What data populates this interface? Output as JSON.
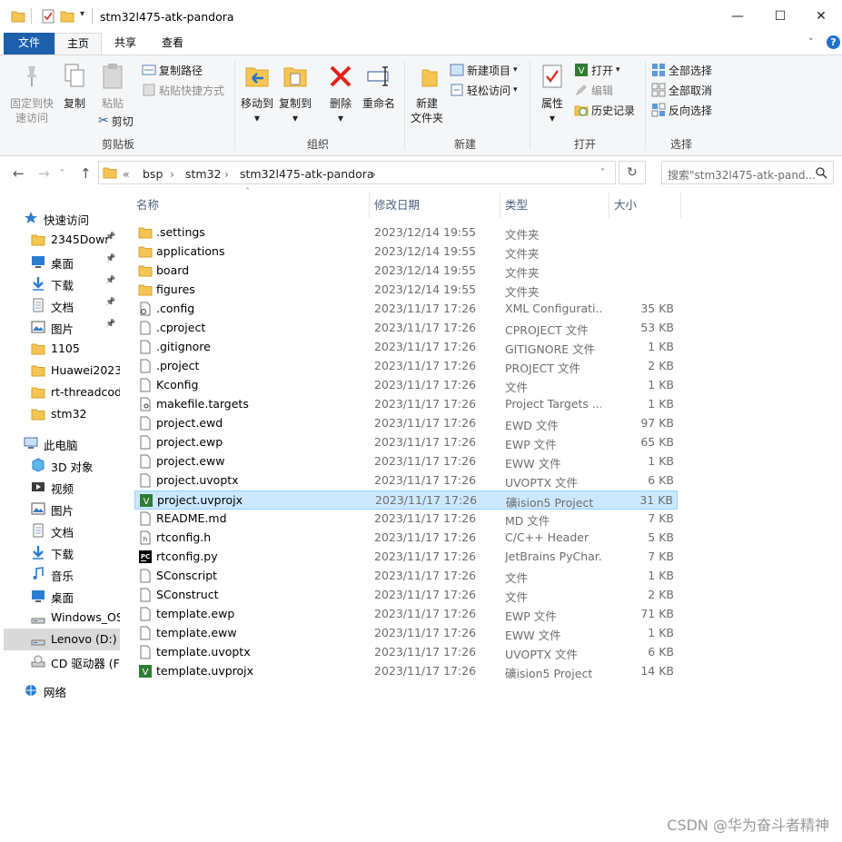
{
  "window": {
    "title": "stm32l475-atk-pandora",
    "minimize": "—",
    "maximize": "☐",
    "close": "✕"
  },
  "ribbon_tabs": [
    "文件",
    "主页",
    "共享",
    "查看"
  ],
  "ribbon": {
    "clipboard": {
      "pin_label_1": "固定到快",
      "pin_label_2": "速访问",
      "copy": "复制",
      "paste": "粘贴",
      "copy_path": "复制路径",
      "paste_shortcut": "粘贴快捷方式",
      "cut": "剪切",
      "group": "剪贴板"
    },
    "organize": {
      "move_to": "移动到",
      "copy_to": "复制到",
      "delete": "删除",
      "rename": "重命名",
      "group": "组织"
    },
    "new": {
      "new_folder_1": "新建",
      "new_folder_2": "文件夹",
      "new_item": "新建项目",
      "easy_access": "轻松访问",
      "group": "新建"
    },
    "open": {
      "properties": "属性",
      "open": "打开",
      "edit": "编辑",
      "history": "历史记录",
      "group": "打开"
    },
    "select": {
      "select_all": "全部选择",
      "select_none": "全部取消",
      "invert": "反向选择",
      "group": "选择"
    }
  },
  "address": {
    "crumbs": [
      "«",
      "bsp",
      "stm32",
      "stm32l475-atk-pandora"
    ],
    "search_placeholder": "搜索\"stm32l475-atk-pand...",
    "search_icon": "search-icon"
  },
  "nav": {
    "items": [
      {
        "label": "快速访问",
        "icon": "star-icon",
        "pinned": false,
        "selected": false
      },
      {
        "label": "2345Dowr",
        "icon": "folder-icon",
        "pinned": true,
        "selected": false
      },
      {
        "label": "桌面",
        "icon": "desktop-icon",
        "pinned": true,
        "selected": false
      },
      {
        "label": "下载",
        "icon": "download-icon",
        "pinned": true,
        "selected": false
      },
      {
        "label": "文档",
        "icon": "document-icon",
        "pinned": true,
        "selected": false
      },
      {
        "label": "图片",
        "icon": "pictures-icon",
        "pinned": true,
        "selected": false
      },
      {
        "label": "1105",
        "icon": "folder-icon",
        "pinned": false,
        "selected": false
      },
      {
        "label": "Huawei2023",
        "icon": "folder-icon",
        "pinned": false,
        "selected": false
      },
      {
        "label": "rt-threadcod",
        "icon": "folder-icon",
        "pinned": false,
        "selected": false
      },
      {
        "label": "stm32",
        "icon": "folder-icon",
        "pinned": false,
        "selected": false
      },
      {
        "label": "此电脑",
        "icon": "computer-icon",
        "pinned": false,
        "selected": false
      },
      {
        "label": "3D 对象",
        "icon": "3d-objects-icon",
        "pinned": false,
        "selected": false
      },
      {
        "label": "视频",
        "icon": "videos-icon",
        "pinned": false,
        "selected": false
      },
      {
        "label": "图片",
        "icon": "pictures-icon",
        "pinned": false,
        "selected": false
      },
      {
        "label": "文档",
        "icon": "document-icon",
        "pinned": false,
        "selected": false
      },
      {
        "label": "下载",
        "icon": "download-icon",
        "pinned": false,
        "selected": false
      },
      {
        "label": "音乐",
        "icon": "music-icon",
        "pinned": false,
        "selected": false
      },
      {
        "label": "桌面",
        "icon": "desktop-icon",
        "pinned": false,
        "selected": false
      },
      {
        "label": "Windows_OS",
        "icon": "drive-icon",
        "pinned": false,
        "selected": false
      },
      {
        "label": "Lenovo (D:)",
        "icon": "drive-icon",
        "pinned": false,
        "selected": true
      },
      {
        "label": "CD 驱动器 (F:",
        "icon": "cd-drive-icon",
        "pinned": false,
        "selected": false
      },
      {
        "label": "网络",
        "icon": "network-icon",
        "pinned": false,
        "selected": false
      }
    ]
  },
  "columns": {
    "name": "名称",
    "date": "修改日期",
    "type": "类型",
    "size": "大小"
  },
  "files": [
    {
      "name": ".settings",
      "date": "2023/12/14 19:55",
      "type": "文件夹",
      "size": "",
      "icon": "folder-icon"
    },
    {
      "name": "applications",
      "date": "2023/12/14 19:55",
      "type": "文件夹",
      "size": "",
      "icon": "folder-icon"
    },
    {
      "name": "board",
      "date": "2023/12/14 19:55",
      "type": "文件夹",
      "size": "",
      "icon": "folder-icon"
    },
    {
      "name": "figures",
      "date": "2023/12/14 19:55",
      "type": "文件夹",
      "size": "",
      "icon": "folder-icon"
    },
    {
      "name": ".config",
      "date": "2023/11/17 17:26",
      "type": "XML Configurati...",
      "size": "35 KB",
      "icon": "config-file-icon"
    },
    {
      "name": ".cproject",
      "date": "2023/11/17 17:26",
      "type": "CPROJECT 文件",
      "size": "53 KB",
      "icon": "file-icon"
    },
    {
      "name": ".gitignore",
      "date": "2023/11/17 17:26",
      "type": "GITIGNORE 文件",
      "size": "1 KB",
      "icon": "file-icon"
    },
    {
      "name": ".project",
      "date": "2023/11/17 17:26",
      "type": "PROJECT 文件",
      "size": "2 KB",
      "icon": "file-icon"
    },
    {
      "name": "Kconfig",
      "date": "2023/11/17 17:26",
      "type": "文件",
      "size": "1 KB",
      "icon": "file-icon"
    },
    {
      "name": "makefile.targets",
      "date": "2023/11/17 17:26",
      "type": "Project Targets ...",
      "size": "1 KB",
      "icon": "targets-file-icon"
    },
    {
      "name": "project.ewd",
      "date": "2023/11/17 17:26",
      "type": "EWD 文件",
      "size": "97 KB",
      "icon": "file-icon"
    },
    {
      "name": "project.ewp",
      "date": "2023/11/17 17:26",
      "type": "EWP 文件",
      "size": "65 KB",
      "icon": "file-icon"
    },
    {
      "name": "project.eww",
      "date": "2023/11/17 17:26",
      "type": "EWW 文件",
      "size": "1 KB",
      "icon": "file-icon"
    },
    {
      "name": "project.uvoptx",
      "date": "2023/11/17 17:26",
      "type": "UVOPTX 文件",
      "size": "6 KB",
      "icon": "file-icon"
    },
    {
      "name": "project.uvprojx",
      "date": "2023/11/17 17:26",
      "type": "礦ision5 Project",
      "size": "31 KB",
      "icon": "keil-project-icon",
      "selected": true
    },
    {
      "name": "README.md",
      "date": "2023/11/17 17:26",
      "type": "MD 文件",
      "size": "7 KB",
      "icon": "file-icon"
    },
    {
      "name": "rtconfig.h",
      "date": "2023/11/17 17:26",
      "type": "C/C++ Header",
      "size": "5 KB",
      "icon": "header-file-icon"
    },
    {
      "name": "rtconfig.py",
      "date": "2023/11/17 17:26",
      "type": "JetBrains PyChar...",
      "size": "7 KB",
      "icon": "pycharm-icon"
    },
    {
      "name": "SConscript",
      "date": "2023/11/17 17:26",
      "type": "文件",
      "size": "1 KB",
      "icon": "file-icon"
    },
    {
      "name": "SConstruct",
      "date": "2023/11/17 17:26",
      "type": "文件",
      "size": "2 KB",
      "icon": "file-icon"
    },
    {
      "name": "template.ewp",
      "date": "2023/11/17 17:26",
      "type": "EWP 文件",
      "size": "71 KB",
      "icon": "file-icon"
    },
    {
      "name": "template.eww",
      "date": "2023/11/17 17:26",
      "type": "EWW 文件",
      "size": "1 KB",
      "icon": "file-icon"
    },
    {
      "name": "template.uvoptx",
      "date": "2023/11/17 17:26",
      "type": "UVOPTX 文件",
      "size": "6 KB",
      "icon": "file-icon"
    },
    {
      "name": "template.uvprojx",
      "date": "2023/11/17 17:26",
      "type": "礦ision5 Project",
      "size": "14 KB",
      "icon": "keil-project-icon"
    }
  ],
  "watermark": "CSDN @华为奋斗者精神",
  "colors": {
    "file_tab": "#1e5fab",
    "selection": "#cce8ff",
    "folder": "#f4c552",
    "accent": "#0078d7"
  }
}
